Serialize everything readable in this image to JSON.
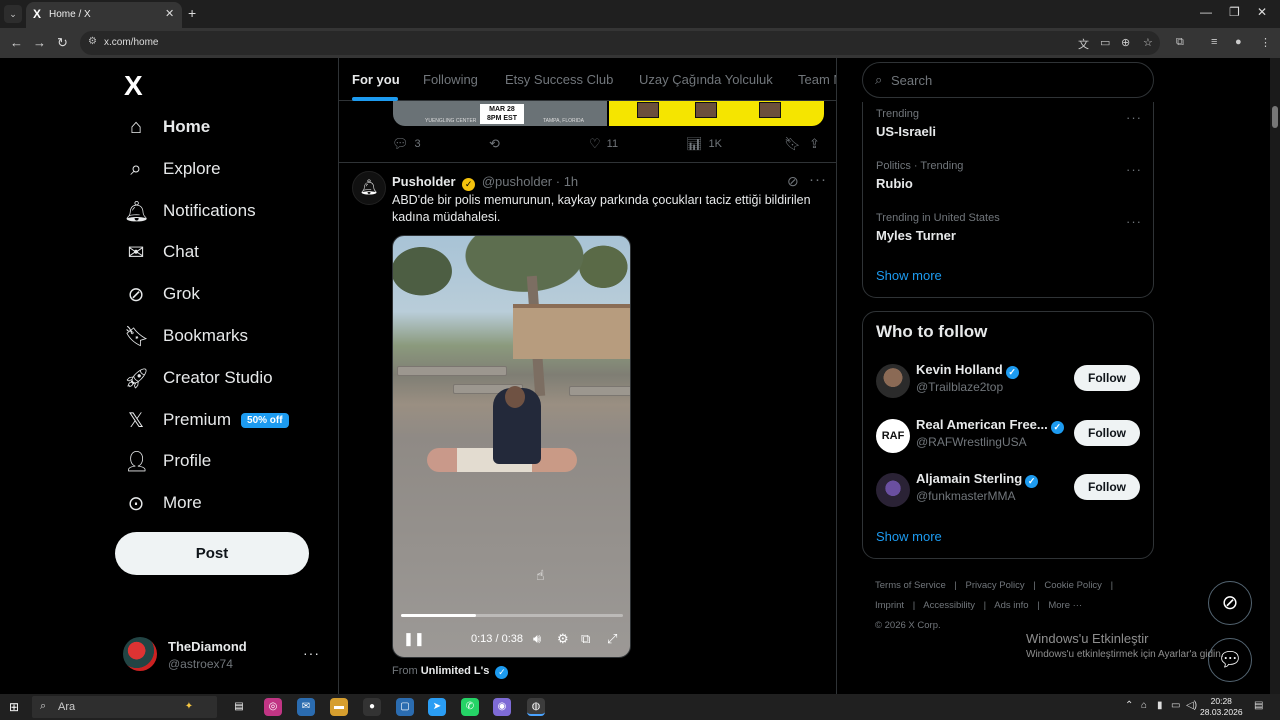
{
  "browser": {
    "tab_title": "Home / X",
    "tab_favicon": "X",
    "url": "x.com/home",
    "tab_list_icon": "chevron-down-icon",
    "close_tab_icon": "close-icon",
    "new_tab_icon": "plus-icon"
  },
  "nav": {
    "logo": "X",
    "items": [
      {
        "label": "Home",
        "icon": "home-icon",
        "active": true
      },
      {
        "label": "Explore",
        "icon": "search-icon"
      },
      {
        "label": "Notifications",
        "icon": "bell-icon"
      },
      {
        "label": "Chat",
        "icon": "mail-icon"
      },
      {
        "label": "Grok",
        "icon": "grok-icon"
      },
      {
        "label": "Bookmarks",
        "icon": "bookmark-icon"
      },
      {
        "label": "Creator Studio",
        "icon": "rocket-icon"
      },
      {
        "label": "Premium",
        "icon": "x-icon",
        "badge": "50% off"
      },
      {
        "label": "Profile",
        "icon": "person-icon"
      },
      {
        "label": "More",
        "icon": "more-circle-icon"
      }
    ],
    "post_label": "Post",
    "profile": {
      "name": "TheDiamond",
      "handle": "@astroex74"
    }
  },
  "timeline": {
    "tabs": [
      "For you",
      "Following",
      "Etsy Success Club",
      "Uzay Çağında Yolculuk",
      "Team M"
    ],
    "prev_post": {
      "media_date": "MAR 28",
      "media_time": "8PM EST",
      "media_venue_left": "YUENGLING CENTER",
      "media_venue_right": "TAMPA, FLORIDA",
      "replies": "3",
      "likes": "11",
      "views": "1K"
    },
    "post": {
      "author": "Pusholder",
      "handle": "@pusholder",
      "time": "1h",
      "text": "ABD'de bir polis memurunun, kaykay parkında çocukları taciz ettiği bildirilen kadına müdahalesi.",
      "video": {
        "current": "0:13",
        "duration": "0:38",
        "progress": 0.34
      },
      "from_label": "From",
      "from_name": "Unlimited L's"
    }
  },
  "sidebar": {
    "search_placeholder": "Search",
    "trends": [
      {
        "category": "Trending",
        "name": "US-Israeli"
      },
      {
        "category": "Politics · Trending",
        "name": "Rubio"
      },
      {
        "category": "Trending in United States",
        "name": "Myles Turner"
      }
    ],
    "trends_show_more": "Show more",
    "who_to_follow_title": "Who to follow",
    "follow": [
      {
        "name": "Kevin Holland",
        "handle": "@Trailblaze2top",
        "avatar": ""
      },
      {
        "name": "Real American Free...",
        "handle": "@RAFWrestlingUSA",
        "avatar": "RAF"
      },
      {
        "name": "Aljamain Sterling",
        "handle": "@funkmasterMMA",
        "avatar": ""
      }
    ],
    "follow_label": "Follow",
    "follow_show_more": "Show more",
    "footer": [
      "Terms of Service",
      "|",
      "Privacy Policy",
      "|",
      "Cookie Policy",
      "|",
      "Imprint",
      "|",
      "Accessibility",
      "|",
      "Ads info",
      "|",
      "More ···",
      "© 2026 X Corp."
    ]
  },
  "watermark": {
    "line1": "Windows'u Etkinleştir",
    "line2": "Windows'u etkinleştirmek için Ayarlar'a gidin."
  },
  "taskbar": {
    "search_text": "Ara",
    "time": "20:28",
    "date": "28.03.2026"
  },
  "colors": {
    "accent": "#1d9bf0",
    "background": "#000000",
    "border": "#2f3336",
    "muted": "#71767b"
  }
}
